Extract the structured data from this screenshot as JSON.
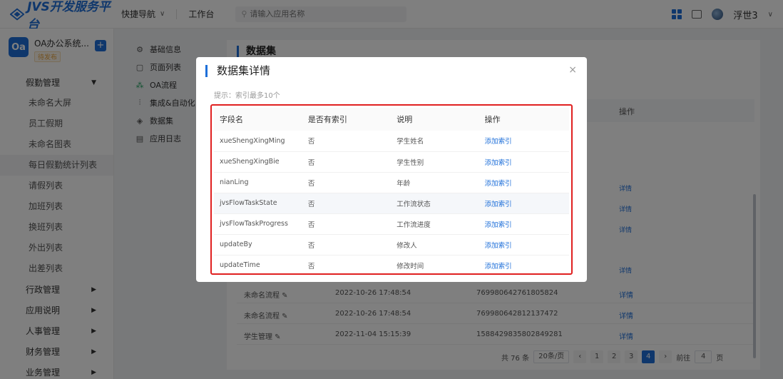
{
  "topbar": {
    "logo_text": "JVS开发服务平台",
    "quick_nav": "快捷导航",
    "workbench": "工作台",
    "search_placeholder": "请输入应用名称",
    "user_name": "浮世3"
  },
  "sidebar": {
    "app_name": "OA办公系统...",
    "app_tag": "待发布",
    "app_icon_text": "Oa",
    "groups_top": [
      {
        "label": "假勤管理"
      }
    ],
    "items": [
      {
        "label": "未命名大屏"
      },
      {
        "label": "员工假期"
      },
      {
        "label": "未命名图表"
      },
      {
        "label": "每日假勤统计列表",
        "active": true
      },
      {
        "label": "请假列表"
      },
      {
        "label": "加班列表"
      },
      {
        "label": "换班列表"
      },
      {
        "label": "外出列表"
      },
      {
        "label": "出差列表"
      }
    ],
    "groups_bottom": [
      {
        "label": "行政管理"
      },
      {
        "label": "应用说明"
      },
      {
        "label": "人事管理"
      },
      {
        "label": "财务管理"
      },
      {
        "label": "业务管理"
      }
    ]
  },
  "subnav": [
    {
      "label": "基础信息",
      "icon": "gear-icon"
    },
    {
      "label": "页面列表",
      "icon": "page-icon"
    },
    {
      "label": "OA流程",
      "icon": "flow-icon"
    },
    {
      "label": "集成&自动化",
      "icon": "integration-icon"
    },
    {
      "label": "数据集",
      "icon": "dataset-icon"
    },
    {
      "label": "应用日志",
      "icon": "log-icon"
    }
  ],
  "main": {
    "title": "数据集",
    "op_header": "操作",
    "right_links": [
      "详情",
      "详情",
      "详情",
      "详情"
    ],
    "rows": [
      {
        "name": "未命名流程 ✎",
        "time": "2022-10-26 17:48:54",
        "id": "769980642761805824",
        "op": "详情"
      },
      {
        "name": "未命名流程 ✎",
        "time": "2022-10-26 17:48:54",
        "id": "769980642812137472",
        "op": "详情"
      },
      {
        "name": "学生管理 ✎",
        "time": "2022-11-04 15:15:39",
        "id": "1588429835802849281",
        "op": "详情"
      }
    ],
    "pager": {
      "total": "共 76 条",
      "page_size": "20条/页",
      "prev": "‹",
      "pages": [
        "1",
        "2",
        "3",
        "4"
      ],
      "current": "4",
      "next": "›",
      "goto_label": "前往",
      "goto_value": "4",
      "page_unit": "页"
    }
  },
  "modal": {
    "title": "数据集详情",
    "close": "×",
    "hint": "提示：索引最多10个",
    "headers": [
      "字段名",
      "是否有索引",
      "说明",
      "操作"
    ],
    "rows": [
      {
        "field": "xueShengXingMing",
        "indexed": "否",
        "desc": "学生姓名",
        "action": "添加索引"
      },
      {
        "field": "xueShengXingBie",
        "indexed": "否",
        "desc": "学生性别",
        "action": "添加索引"
      },
      {
        "field": "nianLing",
        "indexed": "否",
        "desc": "年龄",
        "action": "添加索引"
      },
      {
        "field": "jvsFlowTaskState",
        "indexed": "否",
        "desc": "工作流状态",
        "action": "添加索引"
      },
      {
        "field": "jvsFlowTaskProgress",
        "indexed": "否",
        "desc": "工作流进度",
        "action": "添加索引"
      },
      {
        "field": "updateBy",
        "indexed": "否",
        "desc": "修改人",
        "action": "添加索引"
      },
      {
        "field": "updateTime",
        "indexed": "否",
        "desc": "修改时间",
        "action": "添加索引"
      }
    ]
  },
  "colors": {
    "accent": "#1e6fd9",
    "highlight_border": "#e02020"
  }
}
